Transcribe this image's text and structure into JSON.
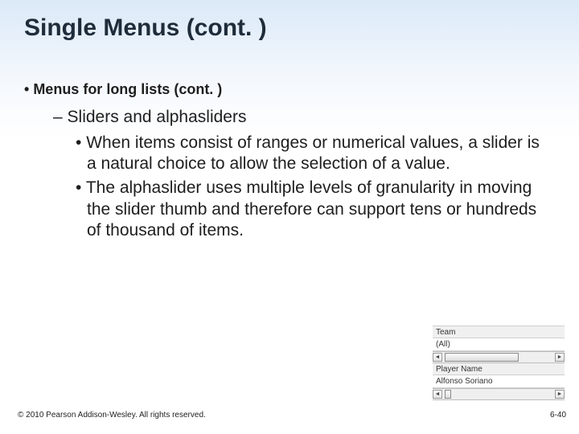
{
  "title": "Single Menus (cont. )",
  "bullets": {
    "l1": "Menus for long lists (cont. )",
    "l2": "Sliders and alphasliders",
    "l3a": "When items consist of ranges or numerical values, a slider is a natural choice to allow the selection of a value.",
    "l3b": "The alphaslider uses multiple levels of granularity in moving the slider thumb and therefore can support tens or hundreds of thousand of items."
  },
  "widget": {
    "label1": "Team",
    "value1": "(All)",
    "label2": "Player Name",
    "value2": "Alfonso Soriano",
    "arrow_left": "◄",
    "arrow_right": "►",
    "thumb1_left_pct": 2,
    "thumb1_width_pct": 66,
    "thumb2_left_pct": 2,
    "thumb2_width_pct": 6
  },
  "footer": {
    "copyright": "© 2010 Pearson Addison-Wesley. All rights reserved.",
    "page": "6-40"
  }
}
